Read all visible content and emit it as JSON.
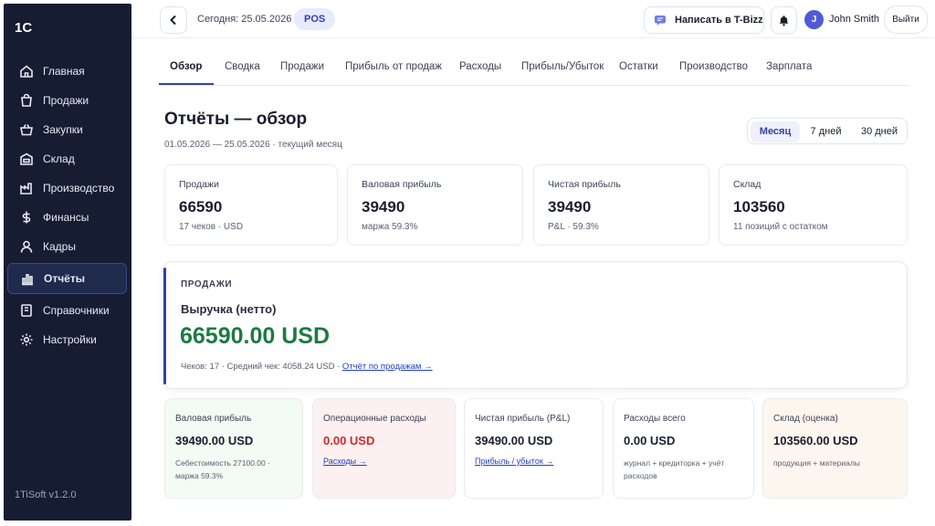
{
  "sidebar": {
    "logo": "1C",
    "version": "1TiSoft v1.2.0",
    "items": [
      {
        "label": "Главная",
        "icon": "home-icon"
      },
      {
        "label": "Продажи",
        "icon": "shopping-bag-icon"
      },
      {
        "label": "Закупки",
        "icon": "basket-icon"
      },
      {
        "label": "Склад",
        "icon": "warehouse-icon"
      },
      {
        "label": "Производство",
        "icon": "factory-icon"
      },
      {
        "label": "Финансы",
        "icon": "dollar-icon"
      },
      {
        "label": "Кадры",
        "icon": "user-icon"
      },
      {
        "label": "Отчёты",
        "icon": "bar-chart-icon",
        "active": true
      },
      {
        "label": "Справочники",
        "icon": "book-icon"
      },
      {
        "label": "Настройки",
        "icon": "gear-icon"
      }
    ]
  },
  "topbar": {
    "today": "Сегодня: 25.05.2026",
    "badge": "POS",
    "tbizz_label": "Написать в T-Bizz",
    "user_initial": "J",
    "user_name": "John Smith",
    "logout_label": "Выйти"
  },
  "tabs": [
    "Обзор",
    "Сводка",
    "Продажи",
    "Прибыль от продаж",
    "Расходы",
    "Прибыль/Убыток",
    "Остатки",
    "Производство",
    "Зарплата"
  ],
  "header": {
    "title": "Отчёты — обзор",
    "subtitle": "01.05.2026 — 25.05.2026 · текущий месяц",
    "periods": [
      "Месяц",
      "7 дней",
      "30 дней"
    ],
    "active_period": "Месяц"
  },
  "kpis": [
    {
      "label": "Продажи",
      "value": "66590",
      "note": "17 чеков · USD"
    },
    {
      "label": "Валовая прибыль",
      "value": "39490",
      "note": "маржа 59.3%"
    },
    {
      "label": "Чистая прибыль",
      "value": "39490",
      "note": "P&L · 59.3%"
    },
    {
      "label": "Склад",
      "value": "103560",
      "note": "11 позиций с остатком"
    }
  ],
  "hero": {
    "kicker": "ПРОДАЖИ",
    "title": "Выручка (нетто)",
    "value": "66590.00 USD",
    "meta": "Чеков: 17 · Средний чек: 4058.24 USD · ",
    "link": "Отчёт по продажам →"
  },
  "cards": [
    {
      "label": "Валовая прибыль",
      "value": "39490.00 USD",
      "note": "Себестоимость 27100.00 · маржа 59.3%",
      "tone": "#f2fbf4"
    },
    {
      "label": "Операционные расходы",
      "value": "0.00 USD",
      "link": "Расходы →",
      "tone": "#fdf0f0",
      "value_color": "#d02a2a"
    },
    {
      "label": "Чистая прибыль (P&L)",
      "value": "39490.00 USD",
      "link": "Прибыль / убыток →",
      "tone": "#ffffff"
    },
    {
      "label": "Расходы всего",
      "value": "0.00 USD",
      "note": "журнал + кредиторка + учёт расходов",
      "tone": "#ffffff"
    },
    {
      "label": "Склад (оценка)",
      "value": "103560.00 USD",
      "note": "продукция + материалы",
      "tone": "#fdf6ee"
    }
  ]
}
